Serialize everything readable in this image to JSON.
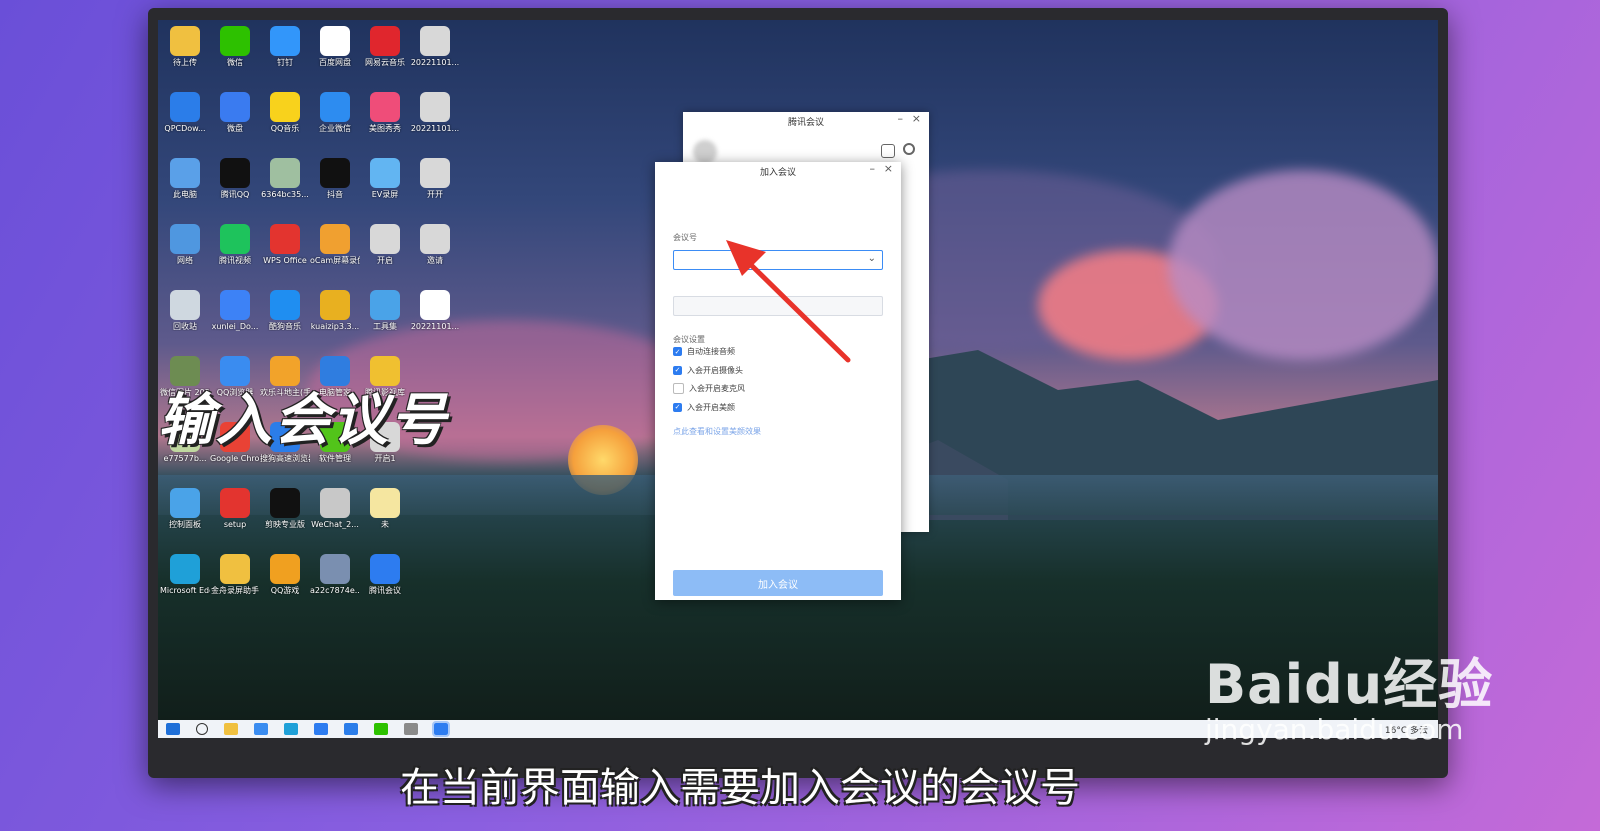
{
  "desktop_icons": [
    {
      "label": "待上传",
      "color": "#f0c040"
    },
    {
      "label": "微信",
      "color": "#2dc100"
    },
    {
      "label": "钉钉",
      "color": "#3296fa"
    },
    {
      "label": "百度网盘",
      "color": "#ffffff"
    },
    {
      "label": "网易云音乐",
      "color": "#e0262d"
    },
    {
      "label": "20221101...",
      "color": "#d8d8d8"
    },
    {
      "label": "QPCDow...",
      "color": "#2b7de9"
    },
    {
      "label": "微盘",
      "color": "#3a7bf0"
    },
    {
      "label": "QQ音乐",
      "color": "#f8d21c"
    },
    {
      "label": "企业微信",
      "color": "#2d8cf0"
    },
    {
      "label": "美图秀秀",
      "color": "#ef4d79"
    },
    {
      "label": "20221101...",
      "color": "#d8d8d8"
    },
    {
      "label": "此电脑",
      "color": "#5aa0e8"
    },
    {
      "label": "腾讯QQ",
      "color": "#111111"
    },
    {
      "label": "6364bc35...",
      "color": "#9fbfa0"
    },
    {
      "label": "抖音",
      "color": "#111111"
    },
    {
      "label": "EV录屏",
      "color": "#62b5f2"
    },
    {
      "label": "开开",
      "color": "#d8d8d8"
    },
    {
      "label": "网络",
      "color": "#4f97e0"
    },
    {
      "label": "腾讯视频",
      "color": "#1ec35c"
    },
    {
      "label": "WPS Office",
      "color": "#e3342f"
    },
    {
      "label": "oCam屏幕录像",
      "color": "#f0a030"
    },
    {
      "label": "开启",
      "color": "#d8d8d8"
    },
    {
      "label": "邀请",
      "color": "#d8d8d8"
    },
    {
      "label": "回收站",
      "color": "#cfd8e0"
    },
    {
      "label": "xunlei_Do...",
      "color": "#3d82f6"
    },
    {
      "label": "酷狗音乐",
      "color": "#1f8ef1"
    },
    {
      "label": "kuaizip3.3...",
      "color": "#e8b020"
    },
    {
      "label": "工具集",
      "color": "#4aa3e8"
    },
    {
      "label": "20221101...",
      "color": "#ffffff"
    },
    {
      "label": "微信图片 2022050...",
      "color": "#6d8c52"
    },
    {
      "label": "QQ浏览器",
      "color": "#3a8cf0"
    },
    {
      "label": "欢乐斗地主(手游电脑版)",
      "color": "#f2a32a"
    },
    {
      "label": "电脑管家",
      "color": "#2f7de0"
    },
    {
      "label": "腾讯影视库",
      "color": "#f0c030"
    },
    {
      "label": "",
      "color": "rgba(0,0,0,0)"
    },
    {
      "label": "e77577b...",
      "color": "#c0d8a0"
    },
    {
      "label": "Google Chrome",
      "color": "#e94235"
    },
    {
      "label": "搜狗高速浏览器",
      "color": "#2b7de9"
    },
    {
      "label": "软件管理",
      "color": "#52c41a"
    },
    {
      "label": "开启1",
      "color": "#d8d8d8"
    },
    {
      "label": "",
      "color": "rgba(0,0,0,0)"
    },
    {
      "label": "控制面板",
      "color": "#4aa3e8"
    },
    {
      "label": "setup",
      "color": "#e3342f"
    },
    {
      "label": "剪映专业版",
      "color": "#111111"
    },
    {
      "label": "WeChat_2...",
      "color": "#c8c8c8"
    },
    {
      "label": "未",
      "color": "#f5e6a0"
    },
    {
      "label": "",
      "color": "rgba(0,0,0,0)"
    },
    {
      "label": "Microsoft Edge",
      "color": "#1fa0d8"
    },
    {
      "label": "金舟录屏助手",
      "color": "#f0c040"
    },
    {
      "label": "QQ游戏",
      "color": "#f0a020"
    },
    {
      "label": "a22c7874e...",
      "color": "#7a8fb0"
    },
    {
      "label": "腾讯会议",
      "color": "#2d7cf0"
    },
    {
      "label": "",
      "color": "rgba(0,0,0,0)"
    }
  ],
  "back_window": {
    "title": "腾讯会议"
  },
  "join_dialog": {
    "title": "加入会议",
    "meeting_id_label": "会议号",
    "meeting_id_value": "",
    "settings_label": "会议设置",
    "options": [
      {
        "label": "自动连接音频",
        "checked": true
      },
      {
        "label": "入会开启摄像头",
        "checked": true
      },
      {
        "label": "入会开启麦克风",
        "checked": false
      },
      {
        "label": "入会开启美颜",
        "checked": true
      }
    ],
    "link_text": "点此查看和设置美颜效果",
    "join_button": "加入会议"
  },
  "taskbar": {
    "weather": "16°C 多云"
  },
  "overlay_caption": "输入会议号",
  "subtitle": "在当前界面输入需要加入会议的会议号",
  "watermark": {
    "brand": "Baidu经验",
    "url": "jingyan.baidu.com"
  },
  "colors": {
    "accent": "#2d7cf0",
    "button_disabled": "#8dbcf6",
    "arrow": "#e8332a"
  }
}
